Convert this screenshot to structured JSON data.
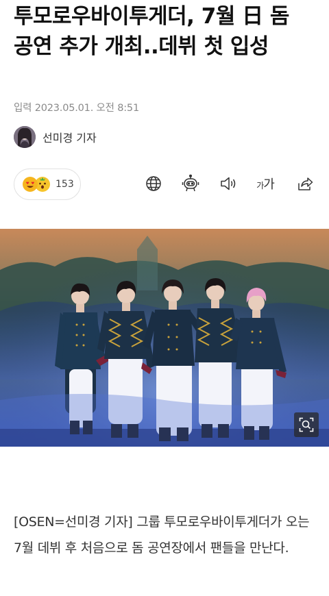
{
  "article": {
    "headline": "투모로우바이투게더, 7월 日 돔 공연 추가 개최..데뷔 첫 입성",
    "published": "입력 2023.05.01. 오전 8:51",
    "author": "선미경 기자",
    "body": "[OSEN=선미경 기자] 그룹 투모로우바이투게더가 오는 7월 데뷔 후 처음으로 돔 공연장에서 팬들을 만난다."
  },
  "reactions": {
    "icons": [
      "heart-eyes-emoji-icon",
      "surprised-emoji-icon"
    ],
    "count": "153"
  },
  "toolbar": {
    "icons": [
      "globe-icon",
      "robot-summary-icon",
      "speaker-icon",
      "font-size-icon",
      "share-icon"
    ],
    "font_small": "가",
    "font_large": "가"
  },
  "photo": {
    "zoom_icon": "zoom-search-icon"
  },
  "colors": {
    "headline": "#111111",
    "meta": "#8a8a8a",
    "body": "#333333",
    "pill_border": "#e2e2e2"
  }
}
